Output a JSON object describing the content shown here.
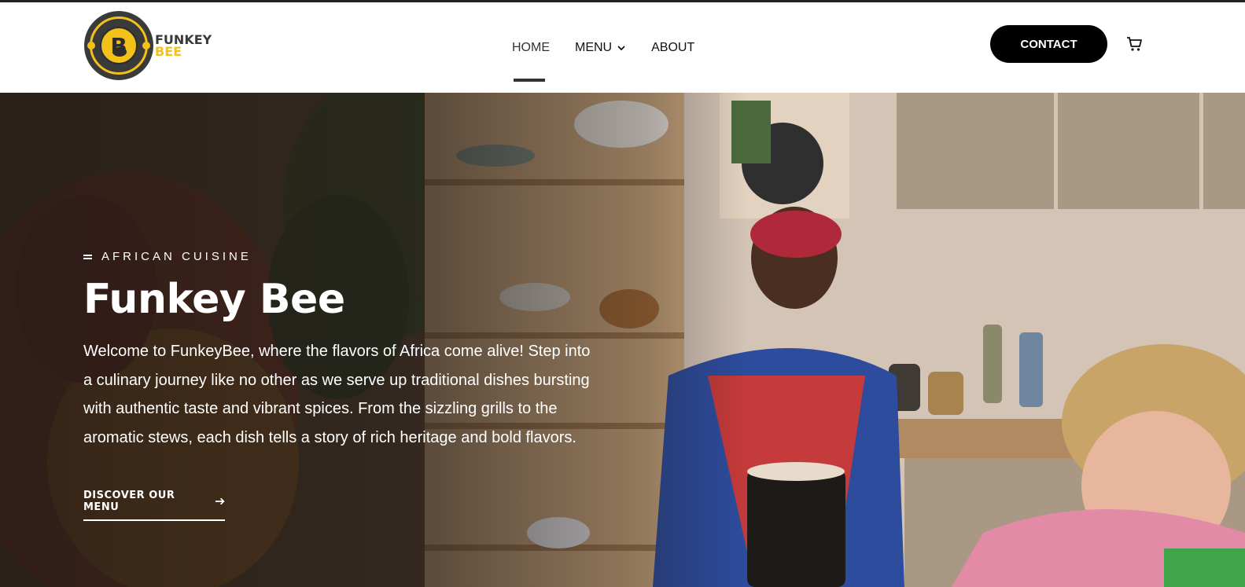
{
  "brand": {
    "logo_letter": "B",
    "line1": "FUNKEY",
    "line2": "BEE",
    "accent_color": "#f2c21b",
    "dark_color": "#3a3a3a"
  },
  "nav": {
    "items": [
      {
        "label": "HOME",
        "active": true
      },
      {
        "label": "MENU",
        "has_dropdown": true
      },
      {
        "label": "ABOUT"
      }
    ],
    "contact_label": "CONTACT",
    "cart_icon": "cart-icon"
  },
  "hero": {
    "eyebrow": "AFRICAN CUISINE",
    "title": "Funkey Bee",
    "text": "Welcome to FunkeyBee, where the flavors of Africa come alive! Step into a culinary journey like no other as we serve up traditional dishes bursting with authentic taste and vibrant spices. From the sizzling grills to the aromatic stews, each dish tells a story of rich heritage and bold flavors.",
    "cta_label": "DISCOVER OUR MENU"
  }
}
